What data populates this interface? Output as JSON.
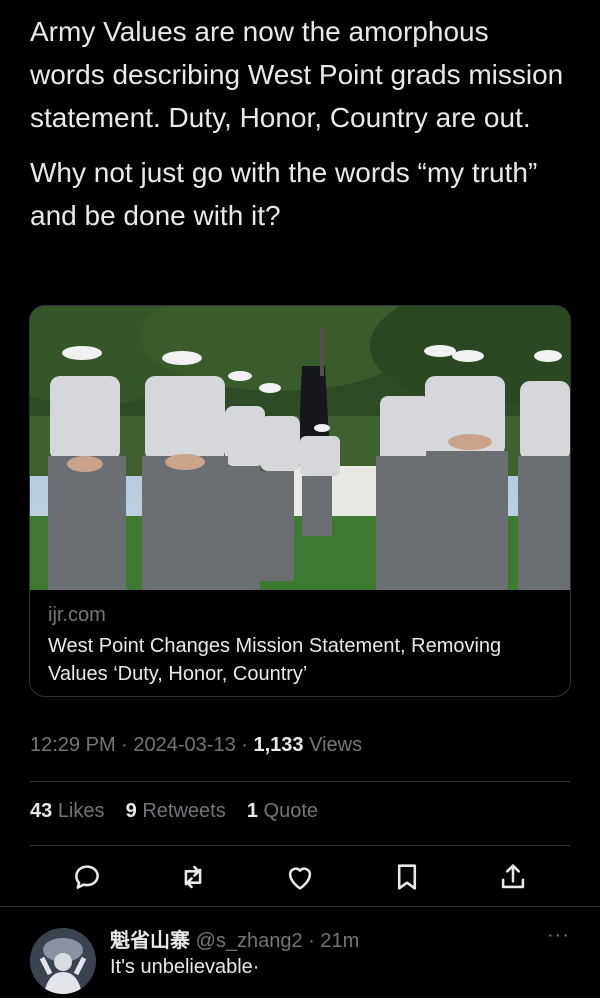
{
  "tweet": {
    "paragraph_1": "Army Values are now the amorphous words describing West Point grads mission statement. Duty, Honor, Country are out.",
    "paragraph_2": "Why not just go with the words “my truth” and be done with it?"
  },
  "card": {
    "domain": "ijr.com",
    "title": "West Point Changes Mission Statement, Removing Values ‘Duty, Honor, Country’"
  },
  "meta": {
    "time": "12:29 PM",
    "date": "2024-03-13",
    "views_count": "1,133",
    "views_label": "Views"
  },
  "stats": {
    "likes_count": "43",
    "likes_label": "Likes",
    "retweets_count": "9",
    "retweets_label": "Retweets",
    "quotes_count": "1",
    "quotes_label": "Quote"
  },
  "actions": [
    "reply-icon",
    "retweet-icon",
    "like-icon",
    "bookmark-icon",
    "share-icon"
  ],
  "reply": {
    "name": "魁省山寨",
    "handle": "@s_zhang2",
    "time": "21m",
    "text": "It's unbelievable·",
    "more": "···"
  },
  "colors": {
    "background": "#000000",
    "text": "#e7e9ea",
    "secondary": "#71767b",
    "border": "#2f3336"
  }
}
